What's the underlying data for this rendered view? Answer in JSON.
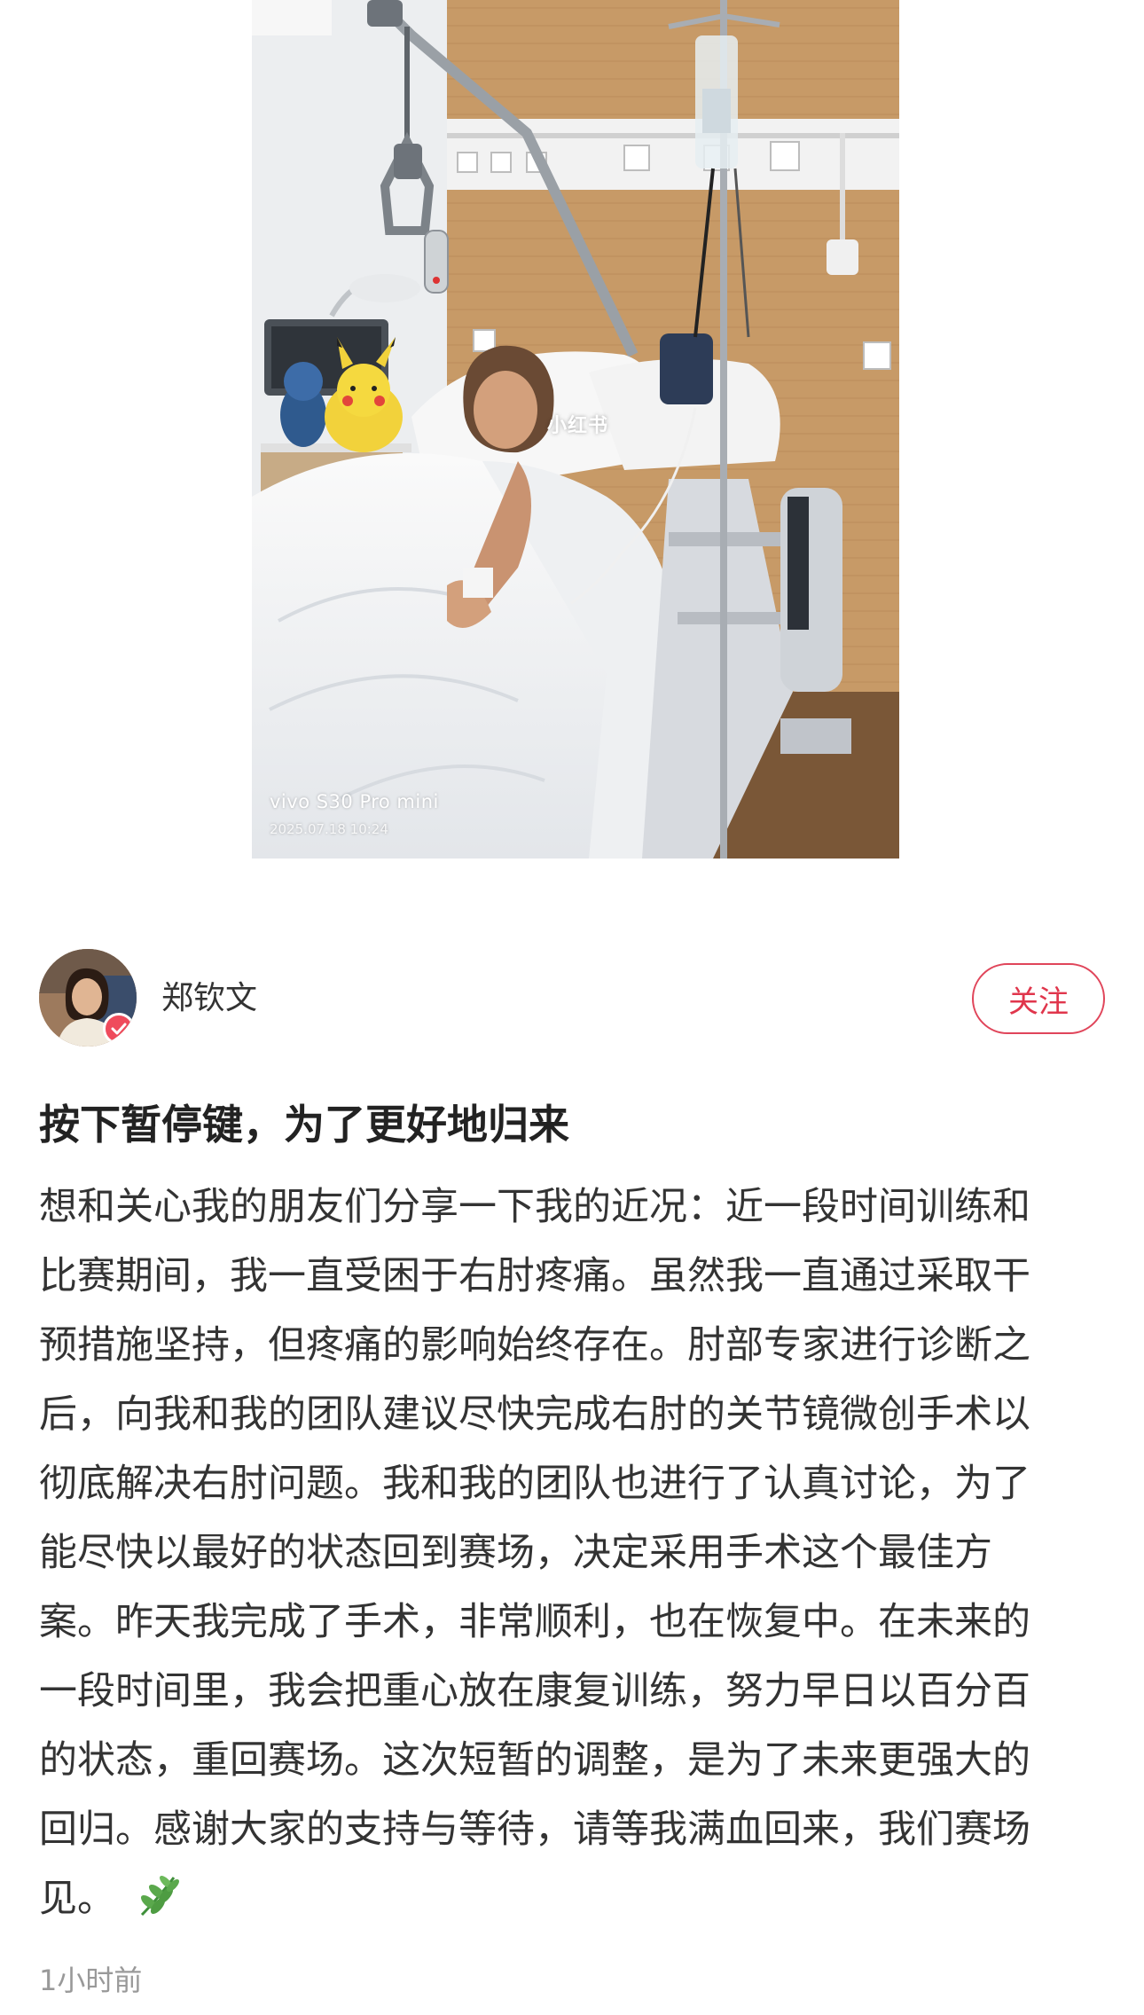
{
  "photo": {
    "watermark": "小红书",
    "camera_model": "vivo S30 Pro mini",
    "camera_timestamp": "2025.07.18 10:24"
  },
  "author": {
    "name": "郑钦文",
    "follow_label": "关注",
    "verified": true
  },
  "post": {
    "title": "按下暂停键，为了更好地归来",
    "body_lines": [
      "想和关心我的朋友们分享一下我的近况：近一段时间训练和",
      "比赛期间，我一直受困于右肘疼痛。虽然我一直通过采取干",
      "预措施坚持，但疼痛的影响始终存在。肘部专家进行诊断之",
      "后，向我和我的团队建议尽快完成右肘的关节镜微创手术以",
      "彻底解决右肘问题。我和我的团队也进行了认真讨论，为了",
      "能尽快以最好的状态回到赛场，决定采用手术这个最佳方",
      "案。昨天我完成了手术，非常顺利，也在恢复中。在未来的",
      "一段时间里，我会把重心放在康复训练，努力早日以百分百",
      "的状态，重回赛场。这次短暂的调整，是为了未来更强大的",
      "回归。感谢大家的支持与等待，请等我满血回来，我们赛场",
      "见。"
    ],
    "emoji": "herb-icon",
    "time_ago": "1小时前"
  },
  "colors": {
    "accent": "#e0364c",
    "badge": "#ef4b5c",
    "muted_text": "#999999"
  }
}
